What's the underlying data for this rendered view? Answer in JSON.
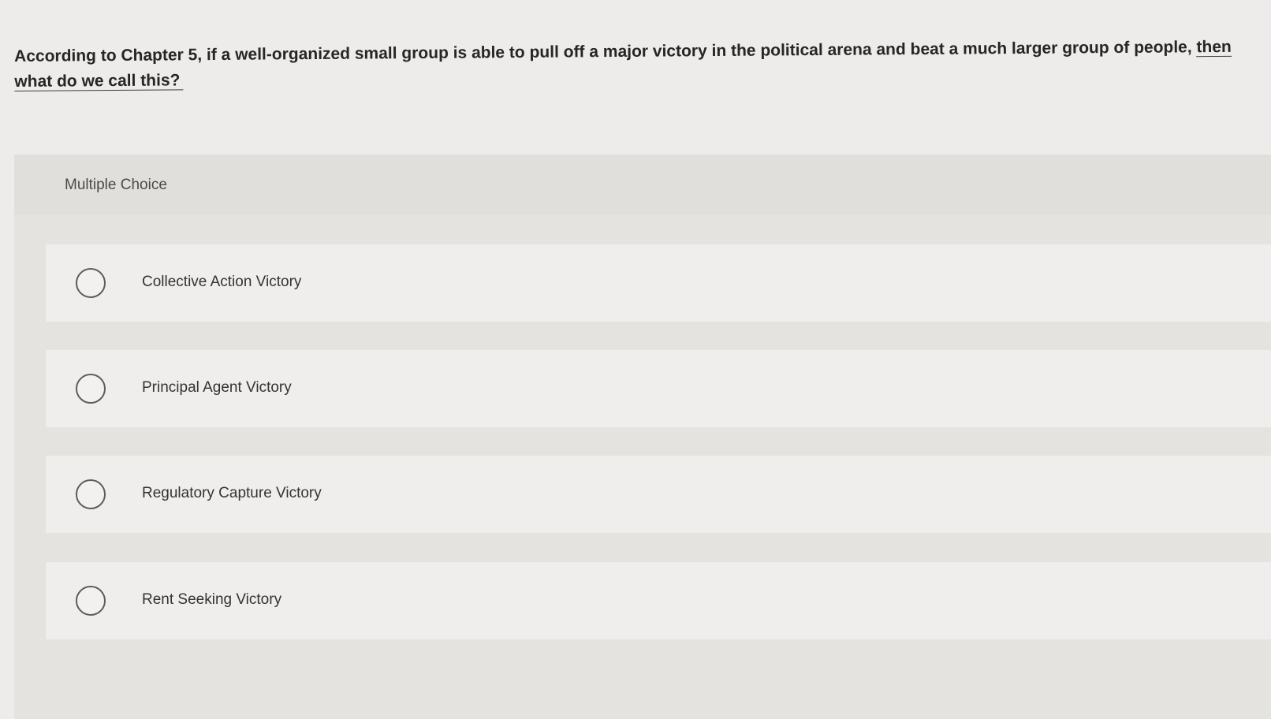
{
  "question": {
    "text_main": "According to Chapter 5, if a well-organized small group is able to pull off a major victory in the political arena and beat a much larger group of people, ",
    "text_underlined": "then what do we call this?"
  },
  "answer_area": {
    "type_label": "Multiple Choice",
    "options": [
      {
        "label": "Collective Action Victory",
        "selected": false
      },
      {
        "label": "Principal Agent Victory",
        "selected": false
      },
      {
        "label": "Regulatory Capture Victory",
        "selected": false
      },
      {
        "label": "Rent Seeking Victory",
        "selected": false
      }
    ]
  },
  "icons": {
    "radio": "radio-button-unchecked-icon"
  },
  "colors": {
    "background": "#edecea",
    "answer_area": "#e4e3e0",
    "option_background": "#efeeec",
    "text": "#262626"
  }
}
